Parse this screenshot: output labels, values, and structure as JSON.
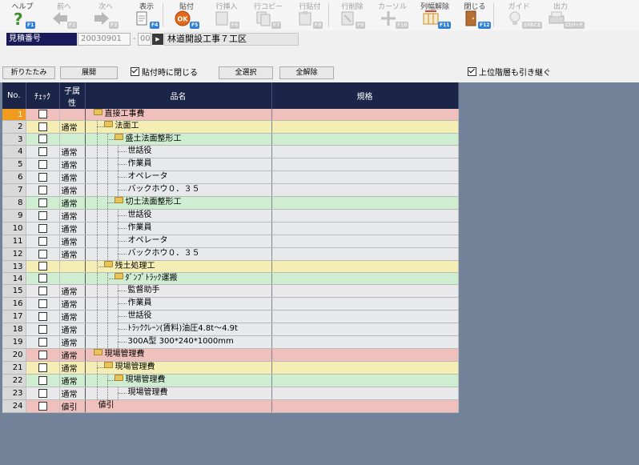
{
  "toolbar": [
    {
      "id": "help",
      "label": "ヘルプ",
      "key": "F1",
      "icon": "help-icon",
      "enabled": true
    },
    {
      "id": "prev",
      "label": "前へ",
      "key": "F2",
      "icon": "prev-arrow-icon",
      "enabled": false
    },
    {
      "id": "next",
      "label": "次へ",
      "key": "F3",
      "icon": "next-arrow-icon",
      "enabled": false
    },
    {
      "id": "view",
      "label": "表示",
      "key": "F4",
      "icon": "view-icon",
      "enabled": true
    },
    {
      "id": "paste",
      "label": "貼付",
      "key": "F5",
      "icon": "ok-icon",
      "enabled": true
    },
    {
      "id": "row-insert",
      "label": "行挿入",
      "key": "F6",
      "icon": "row-insert-icon",
      "enabled": false
    },
    {
      "id": "row-copy",
      "label": "行コピー",
      "key": "F7",
      "icon": "row-copy-icon",
      "enabled": false
    },
    {
      "id": "row-paste",
      "label": "行貼付",
      "key": "F8",
      "icon": "row-paste-icon",
      "enabled": false
    },
    {
      "id": "row-delete",
      "label": "行削除",
      "key": "F9",
      "icon": "row-delete-icon",
      "enabled": false
    },
    {
      "id": "cursor",
      "label": "カーソル",
      "key": "F10",
      "icon": "cursor-icon",
      "enabled": false
    },
    {
      "id": "col-width",
      "label": "列幅解除",
      "key": "F11",
      "icon": "col-width-icon",
      "enabled": true
    },
    {
      "id": "close",
      "label": "閉じる",
      "key": "F12",
      "icon": "close-door-icon",
      "enabled": true
    },
    {
      "id": "guide",
      "label": "ガイド",
      "key": "SPACE",
      "icon": "guide-bulb-icon",
      "enabled": false
    },
    {
      "id": "output",
      "label": "出力",
      "key": "Ctrl+P",
      "icon": "print-icon",
      "enabled": false
    }
  ],
  "estimate": {
    "label": "見積番号",
    "code": "20030901",
    "dash": "-",
    "sub": "00",
    "name": "林道開設工事７工区"
  },
  "actions": {
    "collapse": "折りたたみ",
    "expand": "展開",
    "close_on_paste": "貼付時に閉じる",
    "select_all": "全選択",
    "deselect_all": "全解除",
    "inherit_upper": "上位階層も引き継ぐ"
  },
  "columns": {
    "no": "No.",
    "check": "ﾁｪｯｸ",
    "attr": "子属性",
    "name": "品名",
    "spec": "規格"
  },
  "rows": [
    {
      "no": "1",
      "attr": "",
      "name": "直接工事費",
      "level": 1,
      "folder": true,
      "type": "l1"
    },
    {
      "no": "2",
      "attr": "通常",
      "name": "法面工",
      "level": 2,
      "folder": true,
      "type": "l2"
    },
    {
      "no": "3",
      "attr": "",
      "name": "盛土法面整形工",
      "level": 3,
      "folder": true,
      "type": "l3"
    },
    {
      "no": "4",
      "attr": "通常",
      "name": "世話役",
      "level": 4,
      "folder": false,
      "type": "leaf"
    },
    {
      "no": "5",
      "attr": "通常",
      "name": "作業員",
      "level": 4,
      "folder": false,
      "type": "leaf"
    },
    {
      "no": "6",
      "attr": "通常",
      "name": "オペレータ",
      "level": 4,
      "folder": false,
      "type": "leaf"
    },
    {
      "no": "7",
      "attr": "通常",
      "name": "バックホウ０．３５",
      "level": 4,
      "folder": false,
      "type": "leaf"
    },
    {
      "no": "8",
      "attr": "通常",
      "name": "切土法面整形工",
      "level": 3,
      "folder": true,
      "type": "l3"
    },
    {
      "no": "9",
      "attr": "通常",
      "name": "世話役",
      "level": 4,
      "folder": false,
      "type": "leaf"
    },
    {
      "no": "10",
      "attr": "通常",
      "name": "作業員",
      "level": 4,
      "folder": false,
      "type": "leaf"
    },
    {
      "no": "11",
      "attr": "通常",
      "name": "オペレータ",
      "level": 4,
      "folder": false,
      "type": "leaf"
    },
    {
      "no": "12",
      "attr": "通常",
      "name": "バックホウ０．３５",
      "level": 4,
      "folder": false,
      "type": "leaf"
    },
    {
      "no": "13",
      "attr": "",
      "name": "残土処理工",
      "level": 2,
      "folder": true,
      "type": "l2"
    },
    {
      "no": "14",
      "attr": "",
      "name": "ﾀﾞﾝﾌﾟﾄﾗｯｸ運搬",
      "level": 3,
      "folder": true,
      "type": "l3"
    },
    {
      "no": "15",
      "attr": "通常",
      "name": "監督助手",
      "level": 4,
      "folder": false,
      "type": "leaf"
    },
    {
      "no": "16",
      "attr": "通常",
      "name": "作業員",
      "level": 4,
      "folder": false,
      "type": "leaf"
    },
    {
      "no": "17",
      "attr": "通常",
      "name": "世話役",
      "level": 4,
      "folder": false,
      "type": "leaf"
    },
    {
      "no": "18",
      "attr": "通常",
      "name": "ﾄﾗｯｸｸﾚｰﾝ(賃料)油圧4.8t～4.9t",
      "level": 4,
      "folder": false,
      "type": "leaf"
    },
    {
      "no": "19",
      "attr": "通常",
      "name": "300A型 300*240*1000mm",
      "level": 4,
      "folder": false,
      "type": "leaf"
    },
    {
      "no": "20",
      "attr": "通常",
      "name": "現場管理費",
      "level": 1,
      "folder": true,
      "type": "l1"
    },
    {
      "no": "21",
      "attr": "通常",
      "name": "現場管理費",
      "level": 2,
      "folder": true,
      "type": "l2"
    },
    {
      "no": "22",
      "attr": "通常",
      "name": "現場管理費",
      "level": 3,
      "folder": true,
      "type": "l3"
    },
    {
      "no": "23",
      "attr": "通常",
      "name": "現場管理費",
      "level": 4,
      "folder": false,
      "type": "leaf"
    },
    {
      "no": "24",
      "attr": "値引",
      "name": "値引",
      "level": 1,
      "folder": false,
      "type": "l1"
    }
  ],
  "selected_row": "1",
  "colors": {
    "header_bg": "#1b2547",
    "row_level1": "#f0c0bd",
    "row_level2": "#f5eeb4",
    "row_level3": "#cfeed1",
    "row_leaf": "#e7e9ea",
    "selected_no": "#f29a1d",
    "workspace_bg": "#728299",
    "fkey_badge": "#2f7fd6"
  }
}
